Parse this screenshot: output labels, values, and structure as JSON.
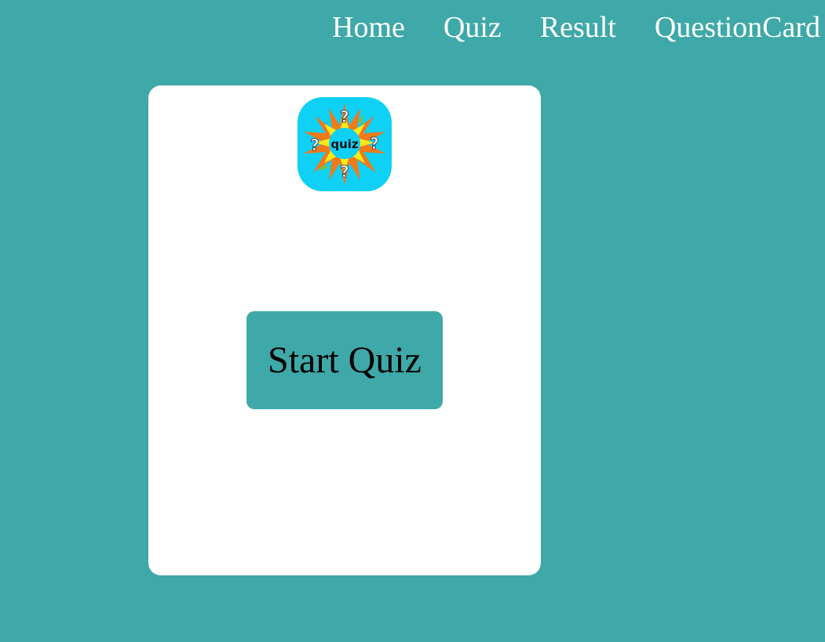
{
  "nav": {
    "items": [
      {
        "label": "Home"
      },
      {
        "label": "Quiz"
      },
      {
        "label": "Result"
      },
      {
        "label": "QuestionCard"
      }
    ]
  },
  "card": {
    "logo": {
      "text": "quiz",
      "marks": [
        "?",
        "?",
        "?",
        "?"
      ],
      "icon": "quiz-logo-icon"
    },
    "start_button_label": "Start Quiz"
  },
  "colors": {
    "background": "#3fa8a8",
    "card": "#ffffff",
    "button": "#3fa8a8",
    "nav_text": "#ffffff",
    "logo_tile": "#0fd0f5",
    "logo_star": "#f6ea1c",
    "logo_burst": "#f07a1a"
  }
}
